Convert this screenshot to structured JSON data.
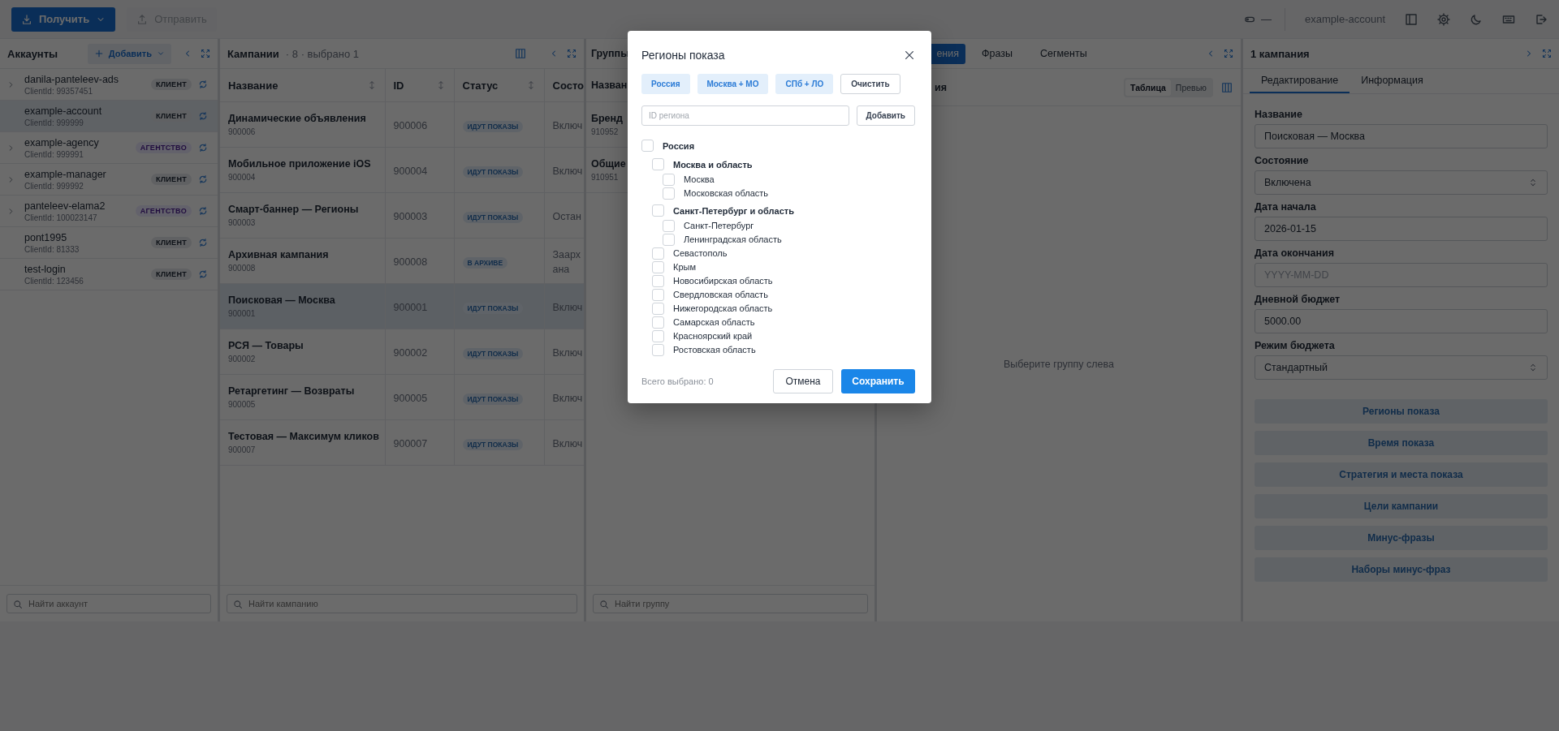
{
  "toolbar": {
    "get_button": {
      "label": "Получить"
    },
    "send_button": {
      "label": "Отправить",
      "disabled": true
    },
    "indicator": "—",
    "account": "example-account"
  },
  "accounts": {
    "title": "Аккаунты",
    "add_button": "Добавить",
    "items": [
      {
        "login": "danila-panteleev-ads",
        "client_id": "ClientId: 99357451",
        "badge": {
          "text": "КЛИЕНТ",
          "kind": "client"
        },
        "expandable": true,
        "selected": false
      },
      {
        "login": "example-account",
        "client_id": "ClientId: 999999",
        "badge": {
          "text": "КЛИЕНТ",
          "kind": "client"
        },
        "expandable": false,
        "selected": true
      },
      {
        "login": "example-agency",
        "client_id": "ClientId: 999991",
        "badge": {
          "text": "АГЕНТСТВО",
          "kind": "agency"
        },
        "expandable": true,
        "selected": false
      },
      {
        "login": "example-manager",
        "client_id": "ClientId: 999992",
        "badge": {
          "text": "КЛИЕНТ",
          "kind": "client"
        },
        "expandable": true,
        "selected": false
      },
      {
        "login": "panteleev-elama2",
        "client_id": "ClientId: 100023147",
        "badge": {
          "text": "АГЕНТСТВО",
          "kind": "agency"
        },
        "expandable": true,
        "selected": false
      },
      {
        "login": "pont1995",
        "client_id": "ClientId: 81333",
        "badge": {
          "text": "КЛИЕНТ",
          "kind": "client"
        },
        "expandable": false,
        "selected": false
      },
      {
        "login": "test-login",
        "client_id": "ClientId: 123456",
        "badge": {
          "text": "КЛИЕНТ",
          "kind": "client"
        },
        "expandable": false,
        "selected": false
      }
    ],
    "search": {
      "placeholder": "Найти аккаунт"
    }
  },
  "campaigns": {
    "title": "Кампании",
    "summary": "· 8 · выбрано 1",
    "columns": [
      "Название",
      "ID",
      "Статус",
      "Состо"
    ],
    "rows": [
      {
        "name": "Динамические объявления",
        "sub_id": "900006",
        "id": "900006",
        "status": "ИДУТ ПОКАЗЫ",
        "state": "Включ",
        "selected": false
      },
      {
        "name": "Мобильное приложение iOS",
        "sub_id": "900004",
        "id": "900004",
        "status": "ИДУТ ПОКАЗЫ",
        "state": "Включ",
        "selected": false
      },
      {
        "name": "Смарт-баннер — Регионы",
        "sub_id": "900003",
        "id": "900003",
        "status": "ИДУТ ПОКАЗЫ",
        "state": "Остан",
        "selected": false
      },
      {
        "name": "Архивная кампания",
        "sub_id": "900008",
        "id": "900008",
        "status": "В АРХИВЕ",
        "state": "Заарх\nана",
        "selected": false
      },
      {
        "name": "Поисковая — Москва",
        "sub_id": "900001",
        "id": "900001",
        "status": "ИДУТ ПОКАЗЫ",
        "state": "Включ",
        "selected": true
      },
      {
        "name": "РСЯ — Товары",
        "sub_id": "900002",
        "id": "900002",
        "status": "ИДУТ ПОКАЗЫ",
        "state": "Включ",
        "selected": false
      },
      {
        "name": "Ретаргетинг — Возвраты",
        "sub_id": "900005",
        "id": "900005",
        "status": "ИДУТ ПОКАЗЫ",
        "state": "Включ",
        "selected": false
      },
      {
        "name": "Тестовая — Максимум кликов",
        "sub_id": "900007",
        "id": "900007",
        "status": "ИДУТ ПОКАЗЫ",
        "state": "Включ",
        "selected": false
      }
    ],
    "search": {
      "placeholder": "Найти кампанию"
    }
  },
  "groups": {
    "title": "Группы",
    "columns": [
      "Назван"
    ],
    "rows": [
      {
        "name": "Бренд",
        "id": "910952"
      },
      {
        "name": "Общие",
        "id": "910951"
      }
    ],
    "search": {
      "placeholder": "Найти группу"
    }
  },
  "ads": {
    "tabs": [
      {
        "label": "ения",
        "selected": true
      },
      {
        "label": "Фразы",
        "selected": false
      },
      {
        "label": "Сегменты",
        "selected": false
      }
    ],
    "subtitle": "ия",
    "view_toggle": [
      {
        "label": "Таблица",
        "selected": true
      },
      {
        "label": "Превью",
        "selected": false
      }
    ],
    "empty_text": "Выберите группу слева"
  },
  "details": {
    "title": "1 кампания",
    "tabs": [
      {
        "label": "Редактирование",
        "selected": true
      },
      {
        "label": "Информация",
        "selected": false
      }
    ],
    "fields": [
      {
        "label": "Название",
        "kind": "text",
        "value": "Поисковая — Москва"
      },
      {
        "label": "Состояние",
        "kind": "select",
        "value": "Включена"
      },
      {
        "label": "Дата начала",
        "kind": "text",
        "value": "2026-01-15"
      },
      {
        "label": "Дата окончания",
        "kind": "text",
        "placeholder": "YYYY-MM-DD"
      },
      {
        "label": "Дневной бюджет",
        "kind": "text",
        "value": "5000.00"
      },
      {
        "label": "Режим бюджета",
        "kind": "select",
        "value": "Стандартный"
      }
    ],
    "actions": [
      "Регионы показа",
      "Время показа",
      "Стратегия и места показа",
      "Цели кампании",
      "Минус-фразы",
      "Наборы минус-фраз"
    ]
  },
  "modal": {
    "title": "Регионы показа",
    "presets": [
      {
        "label": "Россия",
        "kind": "preset"
      },
      {
        "label": "Москва + МО",
        "kind": "preset"
      },
      {
        "label": "СПб + ЛО",
        "kind": "preset"
      },
      {
        "label": "Очистить",
        "kind": "clear"
      }
    ],
    "region_input": {
      "placeholder": "ID региона"
    },
    "add_button": "Добавить",
    "tree": [
      {
        "label": "Россия",
        "checked": false,
        "children": [
          {
            "label": "Москва и область",
            "checked": false,
            "children": [
              {
                "label": "Москва",
                "checked": false
              },
              {
                "label": "Московская область",
                "checked": false
              }
            ]
          },
          {
            "label": "Санкт-Петербург и область",
            "checked": false,
            "children": [
              {
                "label": "Санкт-Петербург",
                "checked": false
              },
              {
                "label": "Ленинградская область",
                "checked": false
              }
            ]
          },
          {
            "label": "Севастополь",
            "checked": false
          },
          {
            "label": "Крым",
            "checked": false
          },
          {
            "label": "Новосибирская область",
            "checked": false
          },
          {
            "label": "Свердловская область",
            "checked": false
          },
          {
            "label": "Нижегородская область",
            "checked": false
          },
          {
            "label": "Самарская область",
            "checked": false
          },
          {
            "label": "Красноярский край",
            "checked": false
          },
          {
            "label": "Ростовская область",
            "checked": false
          }
        ]
      }
    ],
    "total": "Всего выбрано: 0",
    "cancel": "Отмена",
    "save": "Сохранить"
  }
}
